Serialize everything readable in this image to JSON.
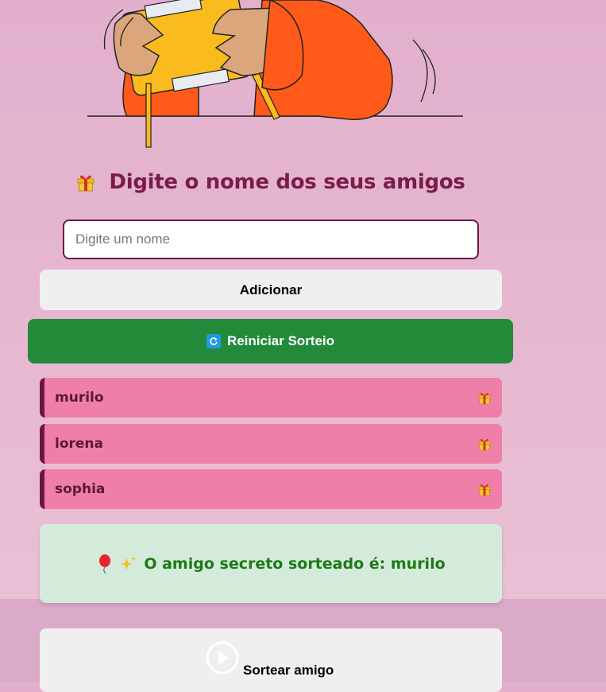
{
  "heading": {
    "title": "Digite o nome dos seus amigos",
    "icon": "gift-icon"
  },
  "input": {
    "placeholder": "Digite um nome",
    "value": ""
  },
  "buttons": {
    "add_label": "Adicionar",
    "reset_label": "Reiniciar Sorteio",
    "reset_icon": "refresh-icon",
    "draw_label": "Sortear amigo",
    "draw_icon": "play-icon"
  },
  "friends": [
    {
      "name": "murilo",
      "icon": "gift-icon"
    },
    {
      "name": "lorena",
      "icon": "gift-icon"
    },
    {
      "name": "sophia",
      "icon": "gift-icon"
    }
  ],
  "result": {
    "text": "O amigo secreto sorteado é: murilo",
    "icons": [
      "balloon-icon",
      "sparkles-icon"
    ]
  },
  "colors": {
    "heading": "#7a1c4a",
    "friend_bg": "#ef7fa8",
    "reset_bg": "#238a3a",
    "result_text": "#1c7a14",
    "result_bg": "#d4ebdb"
  }
}
